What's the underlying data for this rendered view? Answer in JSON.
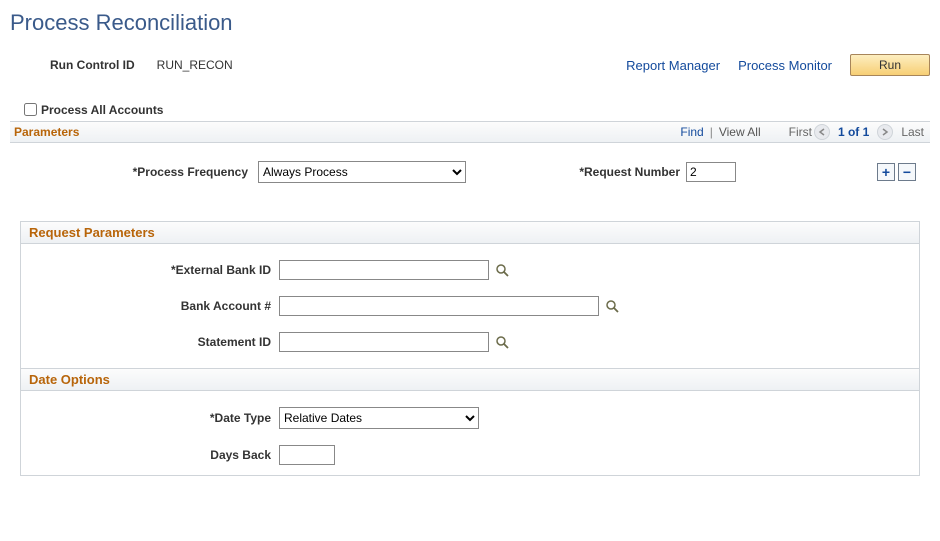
{
  "page_title": "Process Reconciliation",
  "run_control": {
    "label": "Run Control ID",
    "value": "RUN_RECON"
  },
  "links": {
    "report_manager": "Report Manager",
    "process_monitor": "Process Monitor"
  },
  "run_btn": "Run",
  "process_all": {
    "label": "Process All Accounts",
    "checked": false
  },
  "params_bar": {
    "title": "Parameters",
    "find": "Find",
    "viewall": "View All",
    "first": "First",
    "counter": "1 of 1",
    "last": "Last"
  },
  "freq": {
    "label": "*Process Frequency",
    "selected": "Always Process",
    "options": [
      "Always Process"
    ]
  },
  "request_number": {
    "label": "*Request Number",
    "value": "2"
  },
  "request_params": {
    "title": "Request Parameters",
    "external_bank": {
      "label": "*External Bank ID",
      "value": ""
    },
    "bank_account": {
      "label": "Bank Account #",
      "value": ""
    },
    "statement_id": {
      "label": "Statement ID",
      "value": ""
    }
  },
  "date_options": {
    "title": "Date Options",
    "date_type": {
      "label": "*Date Type",
      "selected": "Relative Dates",
      "options": [
        "Relative Dates"
      ]
    },
    "days_back": {
      "label": "Days Back",
      "value": ""
    }
  }
}
